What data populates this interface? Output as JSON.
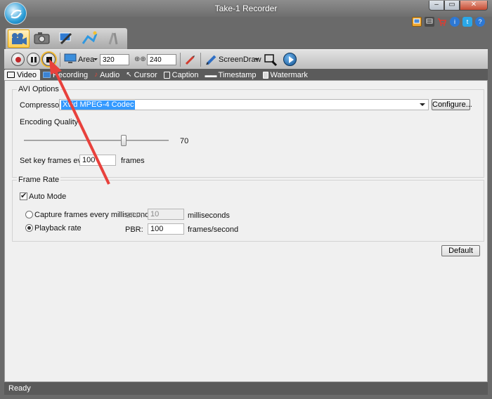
{
  "window": {
    "title": "Take-1 Recorder",
    "min_glyph": "–",
    "max_glyph": "▭",
    "close_glyph": "✕"
  },
  "header_icons": [
    "display-icon",
    "film-icon",
    "cart-icon",
    "info-icon",
    "twitter-icon",
    "help-icon"
  ],
  "mode_tabs": [
    {
      "name": "video-camera-icon",
      "active": true
    },
    {
      "name": "photo-camera-icon",
      "active": false
    },
    {
      "name": "edit-tools-icon",
      "active": false
    },
    {
      "name": "magic-icon",
      "active": false
    },
    {
      "name": "settings-tools-icon",
      "active": false
    }
  ],
  "toolbar": {
    "area_label": "Area",
    "width_value": "320",
    "height_value": "240",
    "screendraw_label": "ScreenDraw"
  },
  "subtabs": [
    "Video",
    "Recording",
    "Audio",
    "Cursor",
    "Caption",
    "Timestamp",
    "Watermark"
  ],
  "avi_options": {
    "legend": "AVI Options",
    "compressor_label": "Compressor:",
    "compressor_value": "Xvid MPEG-4 Codec",
    "configure_label": "Configure...",
    "encoding_quality_label": "Encoding Quality",
    "quality_value": "70",
    "quality_fraction": 0.7,
    "keyframe_label": "Set key frames every",
    "keyframe_value": "100",
    "keyframe_unit": "frames"
  },
  "frame_rate": {
    "legend": "Frame Rate",
    "auto_mode_label": "Auto Mode",
    "auto_mode_checked": true,
    "capture_label": "Capture frames every milliseconds",
    "cpf_label": "CPF:",
    "cpf_value": "10",
    "milliseconds_label": "milliseconds",
    "playback_label": "Playback rate",
    "pbr_label": "PBR:",
    "pbr_value": "100",
    "fps_label": "frames/second",
    "selected": "playback"
  },
  "default_label": "Default",
  "status": "Ready",
  "annotation_color": "#e8413c"
}
